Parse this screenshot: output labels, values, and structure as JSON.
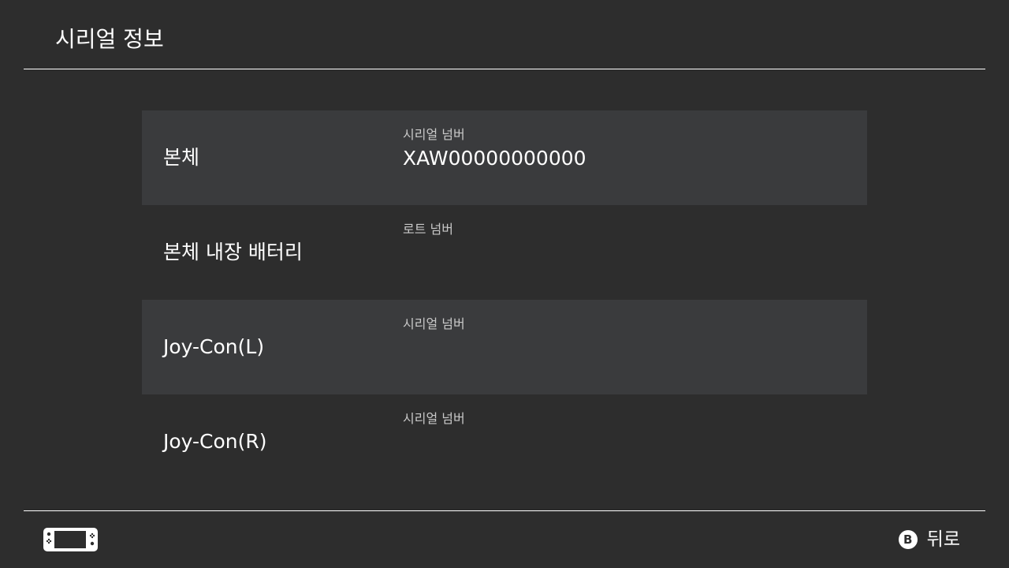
{
  "header": {
    "title": "시리얼 정보"
  },
  "rows": [
    {
      "label": "본체",
      "field_label": "시리얼 넘버",
      "value": "XAW00000000000",
      "shaded": true
    },
    {
      "label": "본체 내장 배터리",
      "field_label": "로트 넘버",
      "value": "",
      "shaded": false
    },
    {
      "label": "Joy-Con(L)",
      "field_label": "시리얼 넘버",
      "value": "",
      "shaded": true
    },
    {
      "label": "Joy-Con(R)",
      "field_label": "시리얼 넘버",
      "value": "",
      "shaded": false
    }
  ],
  "footer": {
    "console_icon": "console-handheld-icon",
    "back_button_glyph": "B",
    "back_label": "뒤로"
  },
  "colors": {
    "background": "#2d2d2d",
    "row_shaded": "#3a3b3d",
    "text": "#ffffff",
    "subtext": "#c8c8c8"
  }
}
